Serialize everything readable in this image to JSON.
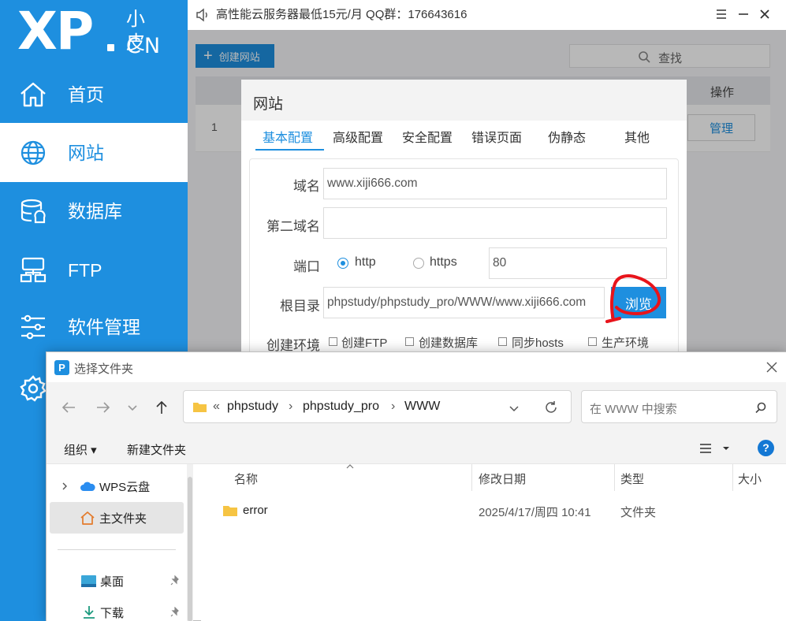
{
  "app": {
    "logo": {
      "main": "XP",
      "small": "小皮",
      "suffix": "CN"
    },
    "notice": "高性能云服务器最低15元/月  QQ群：176643616"
  },
  "sidebar": {
    "items": [
      {
        "label": "首页",
        "icon": "home-icon"
      },
      {
        "label": "网站",
        "icon": "globe-icon",
        "active": true
      },
      {
        "label": "数据库",
        "icon": "database-icon"
      },
      {
        "label": "FTP",
        "icon": "ftp-icon"
      },
      {
        "label": "软件管理",
        "icon": "sliders-icon"
      },
      {
        "label": "",
        "icon": "gear-icon"
      }
    ]
  },
  "content": {
    "create_button": "创建网站",
    "search_placeholder": "查找",
    "table": {
      "action_header": "操作",
      "rows": [
        {
          "index": "1",
          "action": "管理"
        }
      ]
    }
  },
  "site_dialog": {
    "title": "网站",
    "tabs": [
      "基本配置",
      "高级配置",
      "安全配置",
      "错误页面",
      "伪静态",
      "其他"
    ],
    "active_tab": 0,
    "fields": {
      "domain_label": "域名",
      "domain_value": "www.xiji666.com",
      "second_domain_label": "第二域名",
      "second_domain_value": "",
      "port_label": "端口",
      "http_label": "http",
      "https_label": "https",
      "protocol_selected": "http",
      "port_value": "80",
      "root_label": "根目录",
      "root_value": "phpstudy/phpstudy_pro/WWW/www.xiji666.com",
      "browse_label": "浏览",
      "env_label": "创建环境",
      "env_options": [
        "创建FTP",
        "创建数据库",
        "同步hosts",
        "生产环境"
      ]
    }
  },
  "file_dialog": {
    "title": "选择文件夹",
    "breadcrumb": [
      "«",
      "phpstudy",
      "phpstudy_pro",
      "WWW"
    ],
    "search_placeholder": "在 WWW 中搜索",
    "toolbar": {
      "organize": "组织 ▾",
      "new_folder": "新建文件夹"
    },
    "left_nav": [
      {
        "label": "WPS云盘",
        "icon": "cloud-icon"
      },
      {
        "label": "主文件夹",
        "icon": "home-folder-icon",
        "selected": true
      },
      {
        "label": "桌面",
        "icon": "desktop-icon"
      },
      {
        "label": "下载",
        "icon": "download-icon"
      }
    ],
    "columns": [
      "名称",
      "修改日期",
      "类型",
      "大小"
    ],
    "rows": [
      {
        "name": "error",
        "modified": "2025/4/17/周四 10:41",
        "type": "文件夹",
        "size": ""
      }
    ]
  },
  "colors": {
    "accent": "#1e8fdf",
    "annotation": "#e8141b"
  }
}
